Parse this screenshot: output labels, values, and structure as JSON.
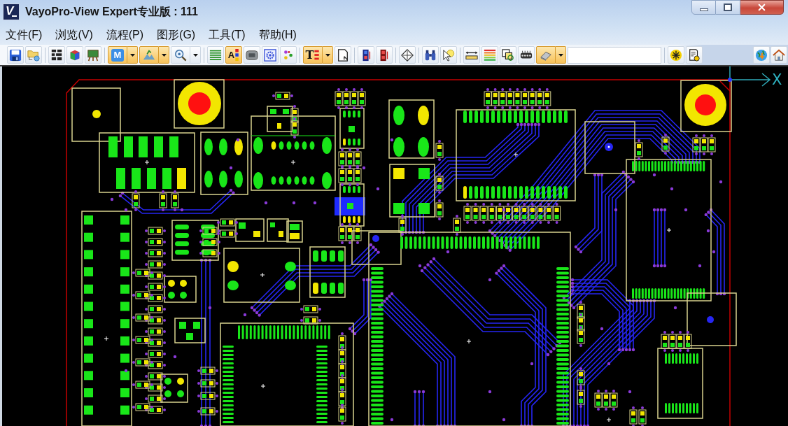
{
  "window": {
    "title": "VayoPro-View Expert专业版 : 111",
    "logo": "V"
  },
  "menu": [
    "文件(F)",
    "浏览(V)",
    "流程(P)",
    "图形(G)",
    "工具(T)",
    "帮助(H)"
  ],
  "toolbar": {
    "groups": [
      {
        "items": [
          {
            "kind": "button",
            "active": false
          },
          {
            "kind": "button",
            "active": false
          }
        ]
      },
      {
        "items": [
          {
            "kind": "button",
            "active": false
          },
          {
            "kind": "button",
            "active": false
          },
          {
            "kind": "button",
            "active": false
          }
        ]
      },
      {
        "items": [
          {
            "kind": "split",
            "active": true,
            "label": "M"
          },
          {
            "kind": "split",
            "active": true
          },
          {
            "kind": "split",
            "active": false
          }
        ]
      },
      {
        "items": [
          {
            "kind": "button",
            "active": false
          },
          {
            "kind": "button",
            "active": true,
            "label": "A"
          },
          {
            "kind": "button",
            "active": false
          },
          {
            "kind": "button",
            "active": false
          },
          {
            "kind": "button",
            "active": false
          }
        ]
      },
      {
        "items": [
          {
            "kind": "split",
            "active": true,
            "label": "T"
          },
          {
            "kind": "button",
            "active": false
          }
        ]
      },
      {
        "items": [
          {
            "kind": "button",
            "active": false
          },
          {
            "kind": "button",
            "active": false
          }
        ]
      },
      {
        "items": [
          {
            "kind": "button",
            "active": false
          }
        ]
      },
      {
        "items": [
          {
            "kind": "button",
            "active": false
          },
          {
            "kind": "button",
            "active": false
          }
        ]
      },
      {
        "items": [
          {
            "kind": "button",
            "active": false
          },
          {
            "kind": "button",
            "active": false
          },
          {
            "kind": "button",
            "active": false
          },
          {
            "kind": "button",
            "active": false
          },
          {
            "kind": "split",
            "active": true
          },
          {
            "kind": "field"
          }
        ]
      },
      {
        "items": [
          {
            "kind": "button",
            "active": false
          },
          {
            "kind": "button",
            "active": false
          }
        ]
      }
    ],
    "right_items": [
      {
        "kind": "button",
        "active": false
      },
      {
        "kind": "button",
        "active": false
      }
    ]
  },
  "canvas": {
    "axis_label": "X"
  }
}
